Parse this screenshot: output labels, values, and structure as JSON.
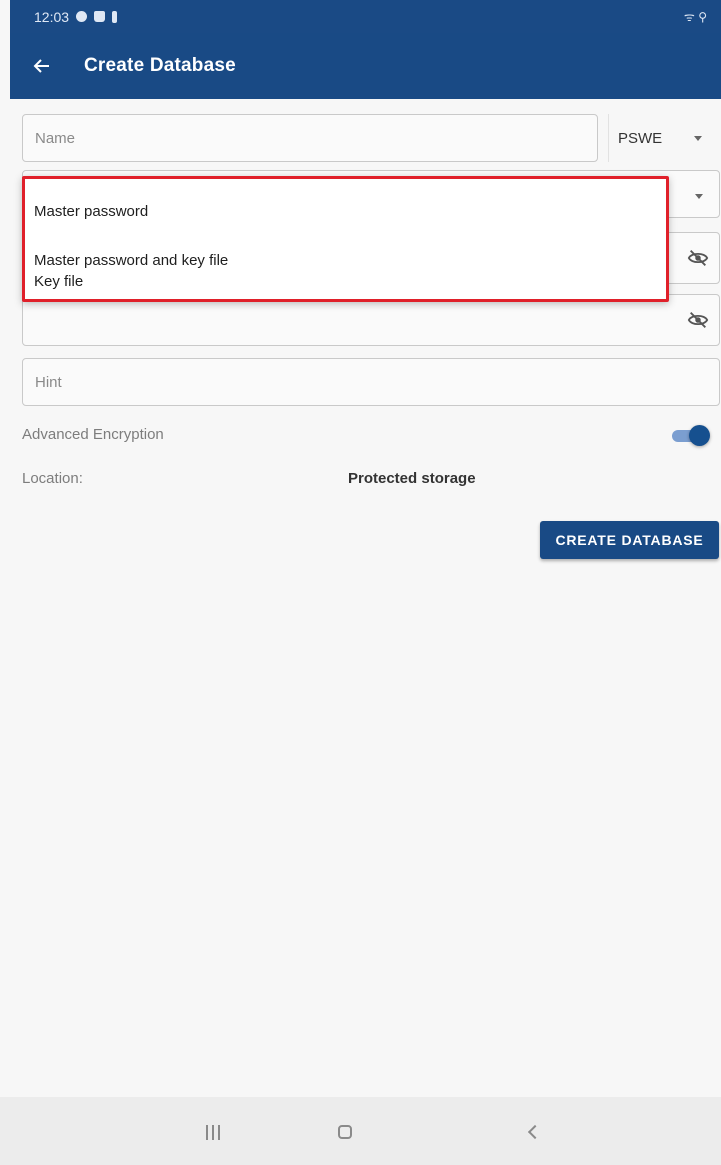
{
  "status_bar": {
    "time": "12:03",
    "right_text": "ᯤ ⚲"
  },
  "app_bar": {
    "title": "Create Database",
    "back_icon": "arrow-left-icon"
  },
  "form": {
    "name_placeholder": "Name",
    "db_type": "PSWE",
    "hint_placeholder": "Hint",
    "advanced_encryption_label": "Advanced Encryption",
    "advanced_encryption_on": true,
    "location_label": "Location:",
    "location_value": "Protected storage",
    "create_button": "CREATE DATABASE"
  },
  "dropdown": {
    "options": [
      "Master password",
      "Master password and key file",
      "Key file"
    ]
  },
  "colors": {
    "primary": "#194a85",
    "highlight_border": "#e0202a",
    "toggle_thumb": "#16508f"
  }
}
